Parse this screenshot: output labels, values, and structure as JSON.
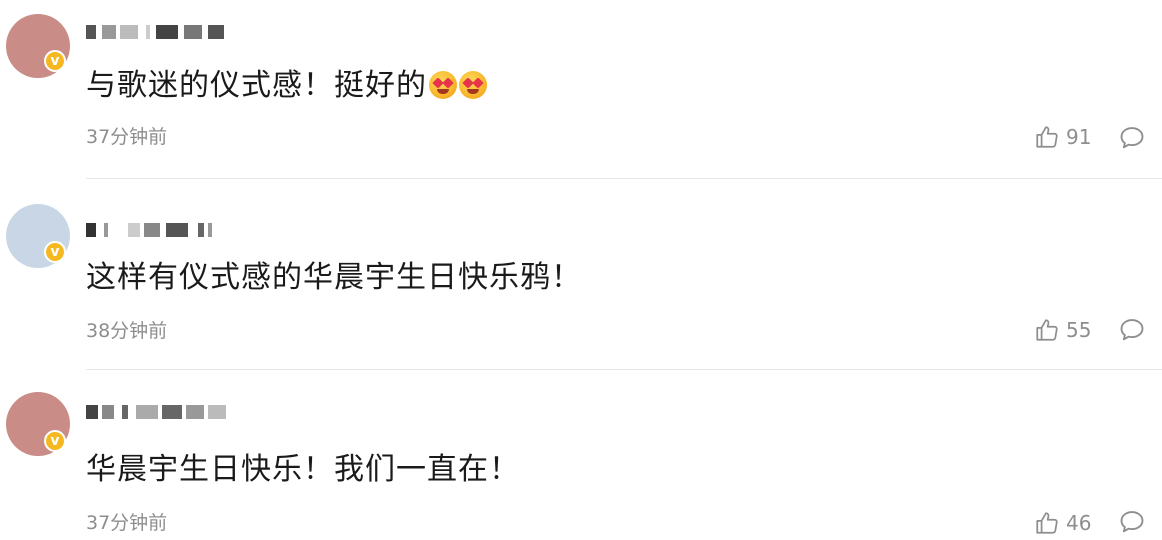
{
  "comments": [
    {
      "text": "与歌迷的仪式感！挺好的",
      "emojis": [
        "heart-eyes-emoji",
        "heart-eyes-emoji"
      ],
      "time": "37分钟前",
      "likes": "91",
      "avatar_colors": [
        "#c98c86",
        "#f1e7e3",
        "#7a3d38",
        "#b4776f"
      ],
      "verified": true
    },
    {
      "text": "这样有仪式感的华晨宇生日快乐鸦！",
      "emojis": [],
      "time": "38分钟前",
      "likes": "55",
      "avatar_colors": [
        "#c9d6e6",
        "#eef2f6",
        "#9fb0c4",
        "#2b2b2b"
      ],
      "verified": true
    },
    {
      "text": "华晨宇生日快乐！我们一直在！",
      "emojis": [],
      "time": "37分钟前",
      "likes": "46",
      "avatar_colors": [
        "#c98c86",
        "#f1e7e3",
        "#7a3d38",
        "#b4776f"
      ],
      "verified": true
    }
  ],
  "colors": {
    "text": "#1a1a1a",
    "meta": "#8e8e8e",
    "divider": "#e8e8e8",
    "verified_badge": "#f5b820"
  },
  "icons": {
    "like": "thumbs-up-icon",
    "reply": "comment-bubble-icon",
    "verified": "verified-v-badge"
  }
}
